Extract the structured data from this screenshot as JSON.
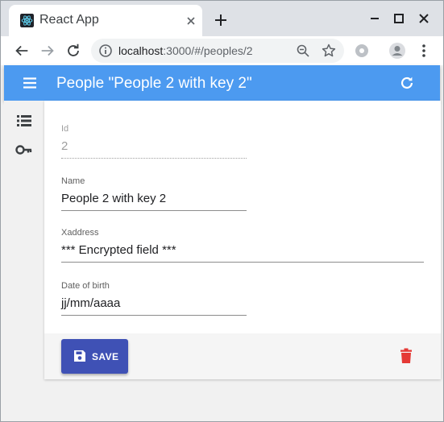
{
  "browser": {
    "tab_title": "React App",
    "url_host": "localhost",
    "url_rest": ":3000/#/peoples/2"
  },
  "appbar": {
    "title": "People \"People 2 with key 2\""
  },
  "form": {
    "id": {
      "label": "Id",
      "value": "2"
    },
    "name": {
      "label": "Name",
      "value": "People 2 with key 2"
    },
    "xaddress": {
      "label": "Xaddress",
      "value": "*** Encrypted field ***"
    },
    "date_of_birth": {
      "label": "Date of birth",
      "value": "jj/mm/aaaa"
    }
  },
  "actions": {
    "save_label": "SAVE"
  },
  "colors": {
    "appbar": "#4c9af0",
    "save_button": "#3f51b5",
    "delete_icon": "#e53935"
  },
  "icons": [
    "react-icon",
    "close-icon",
    "plus-icon",
    "minimize-icon",
    "maximize-icon",
    "close-window-icon",
    "back-icon",
    "forward-icon",
    "reload-icon",
    "info-icon",
    "zoom-icon",
    "star-icon",
    "extension-icon",
    "profile-icon",
    "more-icon",
    "menu-icon",
    "refresh-icon",
    "list-icon",
    "key-icon",
    "save-icon",
    "delete-icon"
  ]
}
